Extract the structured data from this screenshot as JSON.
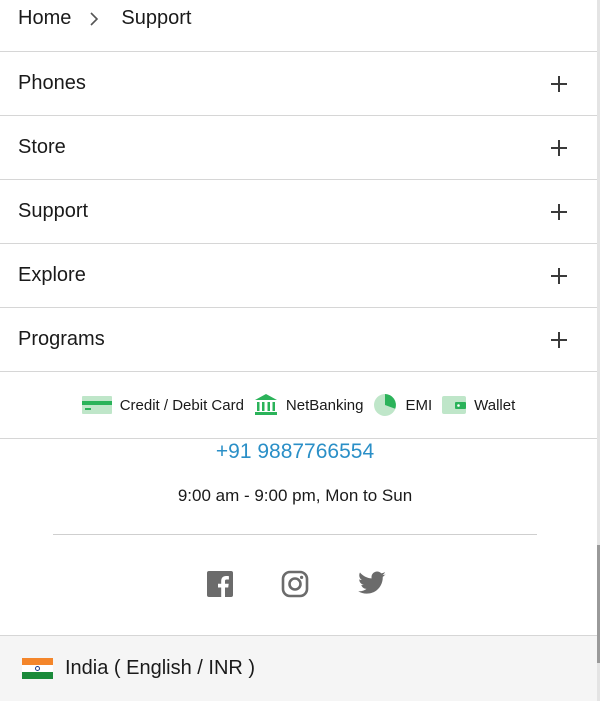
{
  "breadcrumb": {
    "home": "Home",
    "current": "Support",
    "separator_icon": "chevron-right-icon"
  },
  "accordion": [
    {
      "label": "Phones",
      "icon": "plus-icon"
    },
    {
      "label": "Store",
      "icon": "plus-icon"
    },
    {
      "label": "Support",
      "icon": "plus-icon"
    },
    {
      "label": "Explore",
      "icon": "plus-icon"
    },
    {
      "label": "Programs",
      "icon": "plus-icon"
    }
  ],
  "payments": [
    {
      "label": "Credit / Debit Card",
      "icon": "card-icon"
    },
    {
      "label": "NetBanking",
      "icon": "bank-icon"
    },
    {
      "label": "EMI",
      "icon": "pie-icon"
    },
    {
      "label": "Wallet",
      "icon": "wallet-icon"
    }
  ],
  "contact": {
    "phone": "+91 9887766554",
    "hours": "9:00 am - 9:00 pm, Mon to Sun"
  },
  "social": [
    "facebook-icon",
    "instagram-icon",
    "twitter-icon"
  ],
  "footer": {
    "region": "India ( English / INR )",
    "flag_icon": "india-flag-icon"
  },
  "colors": {
    "phone_link": "#2a8fc7",
    "payment_icon": "#2bb35a",
    "social_icon": "#6b6b6b",
    "footer_bg": "#f5f5f5"
  }
}
